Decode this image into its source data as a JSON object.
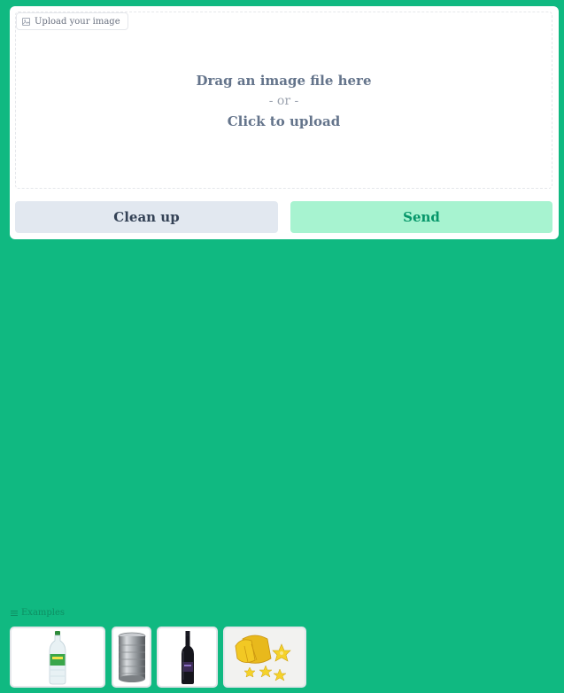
{
  "upload": {
    "label": "Upload your image",
    "drag_text": "Drag an image file here",
    "or_text": "- or -",
    "click_text": "Click to upload"
  },
  "buttons": {
    "clear": "Clean up",
    "send": "Send"
  },
  "examples": {
    "label": "Examples",
    "items": [
      {
        "name": "soda-bottle",
        "icon": "green-soda-bottle"
      },
      {
        "name": "tin-can",
        "icon": "metal-tin-can"
      },
      {
        "name": "wine-bottle",
        "icon": "dark-wine-bottle"
      },
      {
        "name": "starfruit",
        "icon": "sliced-starfruit"
      }
    ]
  },
  "colors": {
    "background": "#10b981",
    "panel": "#ffffff",
    "clear_button": "#e2e8f0",
    "send_button": "#a7f3d0",
    "send_text": "#059669"
  }
}
